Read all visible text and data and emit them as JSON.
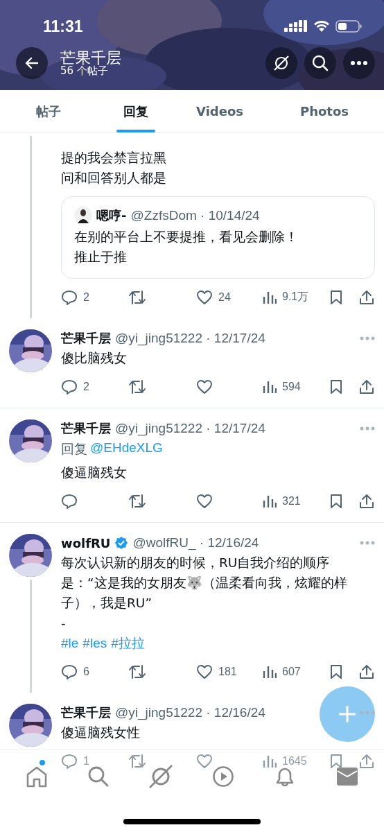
{
  "status_bar": {
    "time": "11:31"
  },
  "header": {
    "title": "芒果千层",
    "subtitle": "56 个帖子"
  },
  "tabs": [
    {
      "label": "帖子",
      "selected": false
    },
    {
      "label": "回复",
      "selected": true
    },
    {
      "label": "Videos",
      "selected": false
    },
    {
      "label": "Photos",
      "selected": false
    }
  ],
  "posts": [
    {
      "thread_below": true,
      "lines": [
        "提的我会禁言拉黑",
        "问和回答别人都是"
      ],
      "quote": {
        "name": "嗯哼-",
        "meta": "@ZzfsDom · 10/14/24",
        "lines": [
          "在别的平台上不要提推，看见会删除！",
          "推止于推"
        ]
      },
      "stats": {
        "replies": "2",
        "likes": "24",
        "views": "9.1万"
      }
    },
    {
      "name": "芒果千层",
      "verified": false,
      "meta": "@yi_jing51222 · 12/17/24",
      "thread_below": false,
      "lines": [
        "傻比脑残女"
      ],
      "stats": {
        "replies": "2",
        "views": "594"
      }
    },
    {
      "name": "芒果千层",
      "verified": false,
      "meta": "@yi_jing51222 · 12/17/24",
      "reply_label": "回复",
      "reply_to": "@EHdeXLG",
      "thread_below": false,
      "lines": [
        "傻逼脑残女"
      ],
      "stats": {
        "views": "321"
      }
    },
    {
      "name": "wolfRU",
      "verified": true,
      "meta": "@wolfRU_ · 12/16/24",
      "thread_below": true,
      "lines": [
        "每次认识新的朋友的时候，RU自我介绍的顺序是：“这是我的女朋友🐺（温柔看向我，炫耀的样子），我是RU”",
        "-"
      ],
      "hashtags": [
        "#le",
        "#les",
        "#拉拉"
      ],
      "stats": {
        "replies": "6",
        "likes": "181",
        "views": "607"
      }
    },
    {
      "name": "芒果千层",
      "verified": false,
      "meta": "@yi_jing51222 · 12/16/24",
      "thread_below": false,
      "lines": [
        "傻逼脑残女性"
      ],
      "stats": {
        "replies": "1",
        "views": "1645"
      }
    }
  ],
  "nav": [
    {
      "kind": "home",
      "unread": true
    },
    {
      "kind": "search",
      "unread": false
    },
    {
      "kind": "grok",
      "unread": false
    },
    {
      "kind": "video",
      "unread": false
    },
    {
      "kind": "bell",
      "unread": false
    },
    {
      "kind": "mail",
      "unread": false
    }
  ]
}
